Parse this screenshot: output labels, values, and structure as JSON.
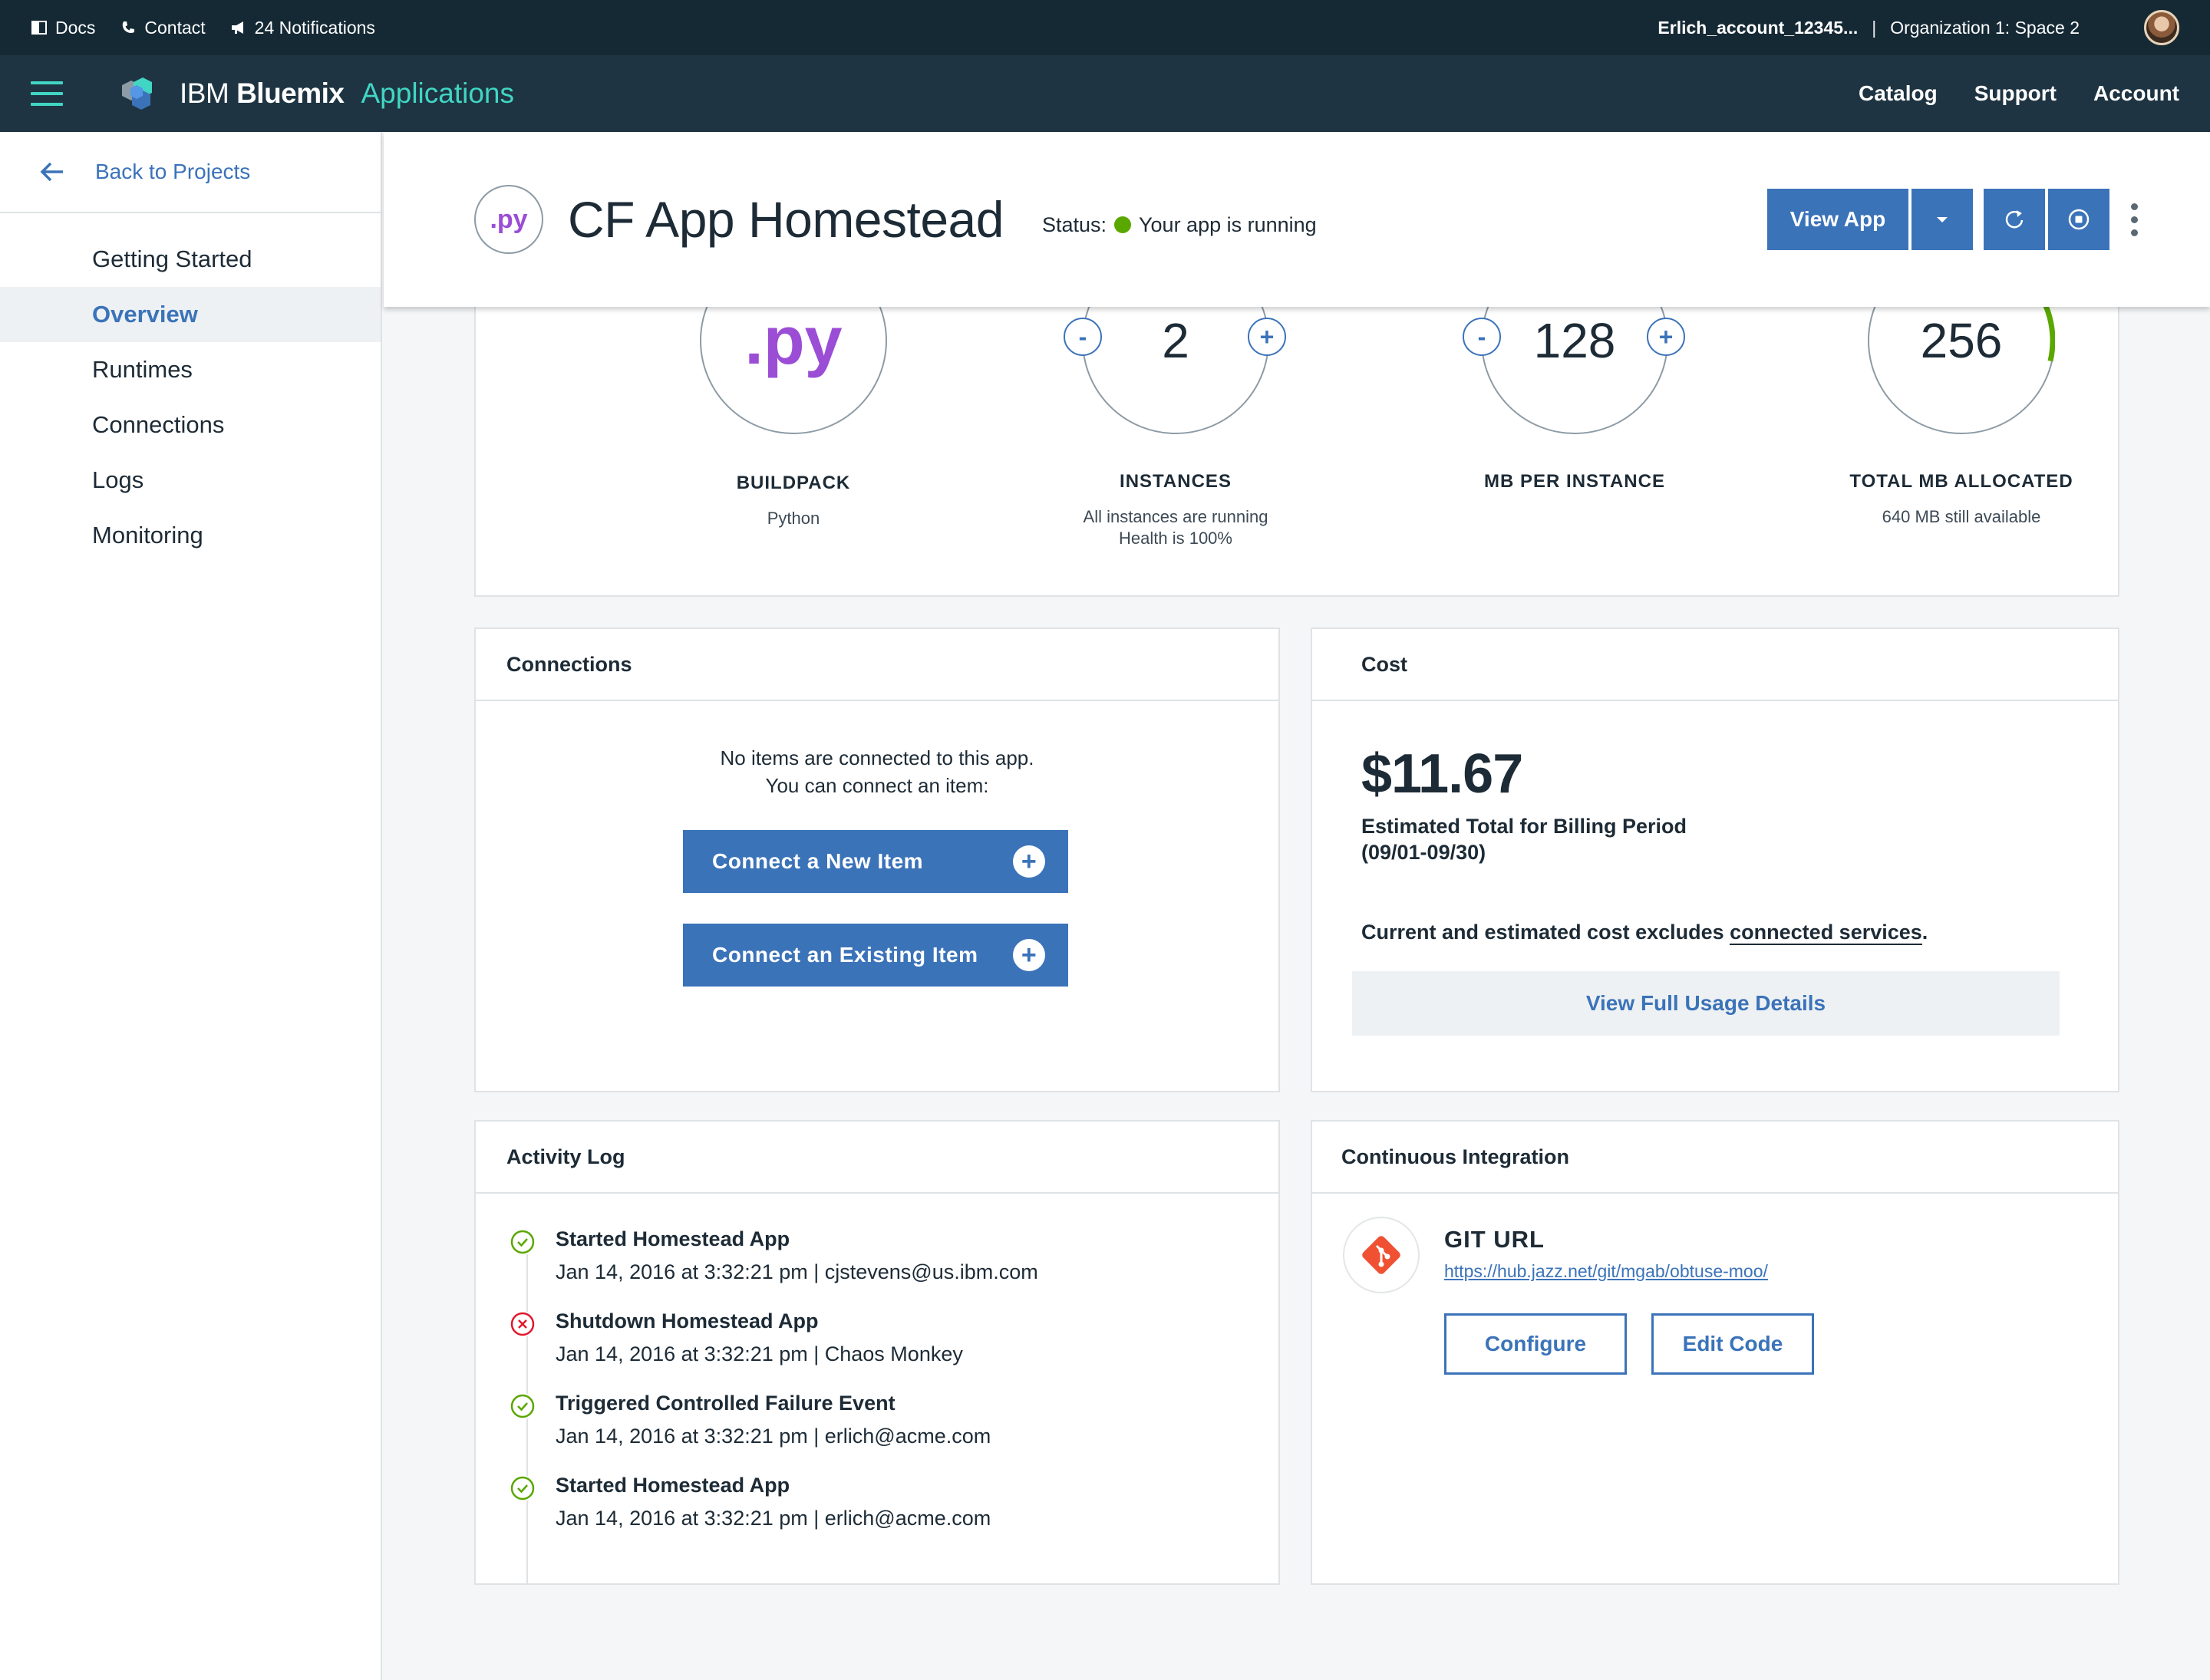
{
  "utilbar": {
    "docs": "Docs",
    "contact": "Contact",
    "notifications": "24 Notifications",
    "account": "Erlich_account_12345...",
    "separator": "|",
    "org_space": "Organization 1: Space 2"
  },
  "navbar": {
    "brand_prefix": "IBM ",
    "brand_name": "Bluemix",
    "section": "Applications",
    "links": [
      "Catalog",
      "Support",
      "Account"
    ]
  },
  "sidebar": {
    "back_label": "Back to Projects",
    "items": [
      {
        "label": "Getting Started"
      },
      {
        "label": "Overview",
        "active": true
      },
      {
        "label": "Runtimes"
      },
      {
        "label": "Connections"
      },
      {
        "label": "Logs"
      },
      {
        "label": "Monitoring"
      }
    ]
  },
  "header": {
    "icon_text": ".py",
    "title": "CF App Homestead",
    "status_label": "Status:",
    "status_text": "Your app is running",
    "status_color": "#5aa700",
    "view_app_label": "View App"
  },
  "metrics": {
    "buildpack": {
      "value": ".py",
      "label": "BUILDPACK",
      "sub": "Python"
    },
    "instances": {
      "value": "2",
      "minus": "-",
      "plus": "+",
      "label": "INSTANCES",
      "sub1": "All instances are running",
      "sub2": "Health is 100%"
    },
    "mb_per_instance": {
      "value": "128",
      "minus": "-",
      "plus": "+",
      "label": "MB PER INSTANCE"
    },
    "total_mb": {
      "value": "256",
      "label": "TOTAL MB ALLOCATED",
      "sub": "640 MB still available",
      "fraction_used": 0.286,
      "arc_color": "#5aa700"
    }
  },
  "connections": {
    "title": "Connections",
    "empty_line1": "No items are connected to this app.",
    "empty_line2": "You can connect an item:",
    "new_item": "Connect a New Item",
    "existing_item": "Connect an Existing Item",
    "plus": "+"
  },
  "cost": {
    "title": "Cost",
    "amount": "$11.67",
    "label_line1": "Estimated Total for Billing Period",
    "label_line2": "(09/01-09/30)",
    "note_prefix": "Current and estimated cost excludes ",
    "note_link": "connected services",
    "note_suffix": ".",
    "usage_button": "View Full Usage Details"
  },
  "activity": {
    "title": "Activity Log",
    "items": [
      {
        "status": "success",
        "title": "Started Homestead App",
        "meta": "Jan 14, 2016 at 3:32:21 pm | cjstevens@us.ibm.com"
      },
      {
        "status": "error",
        "title": "Shutdown Homestead App",
        "meta": "Jan 14, 2016 at 3:32:21 pm | Chaos Monkey"
      },
      {
        "status": "success",
        "title": "Triggered Controlled Failure Event",
        "meta": "Jan 14, 2016 at 3:32:21 pm | erlich@acme.com"
      },
      {
        "status": "success",
        "title": "Started Homestead App",
        "meta": "Jan 14, 2016 at 3:32:21 pm | erlich@acme.com"
      }
    ]
  },
  "ci": {
    "title": "Continuous Integration",
    "git_title": "GIT URL",
    "git_url": "https://hub.jazz.net/git/mgab/obtuse-moo/",
    "configure": "Configure",
    "edit_code": "Edit Code"
  },
  "colors": {
    "primary": "#3b73b9",
    "accent": "#41d6c3",
    "success": "#5aa700",
    "error": "#e0182d",
    "nav_bg": "#1e3442",
    "util_bg": "#152935"
  }
}
